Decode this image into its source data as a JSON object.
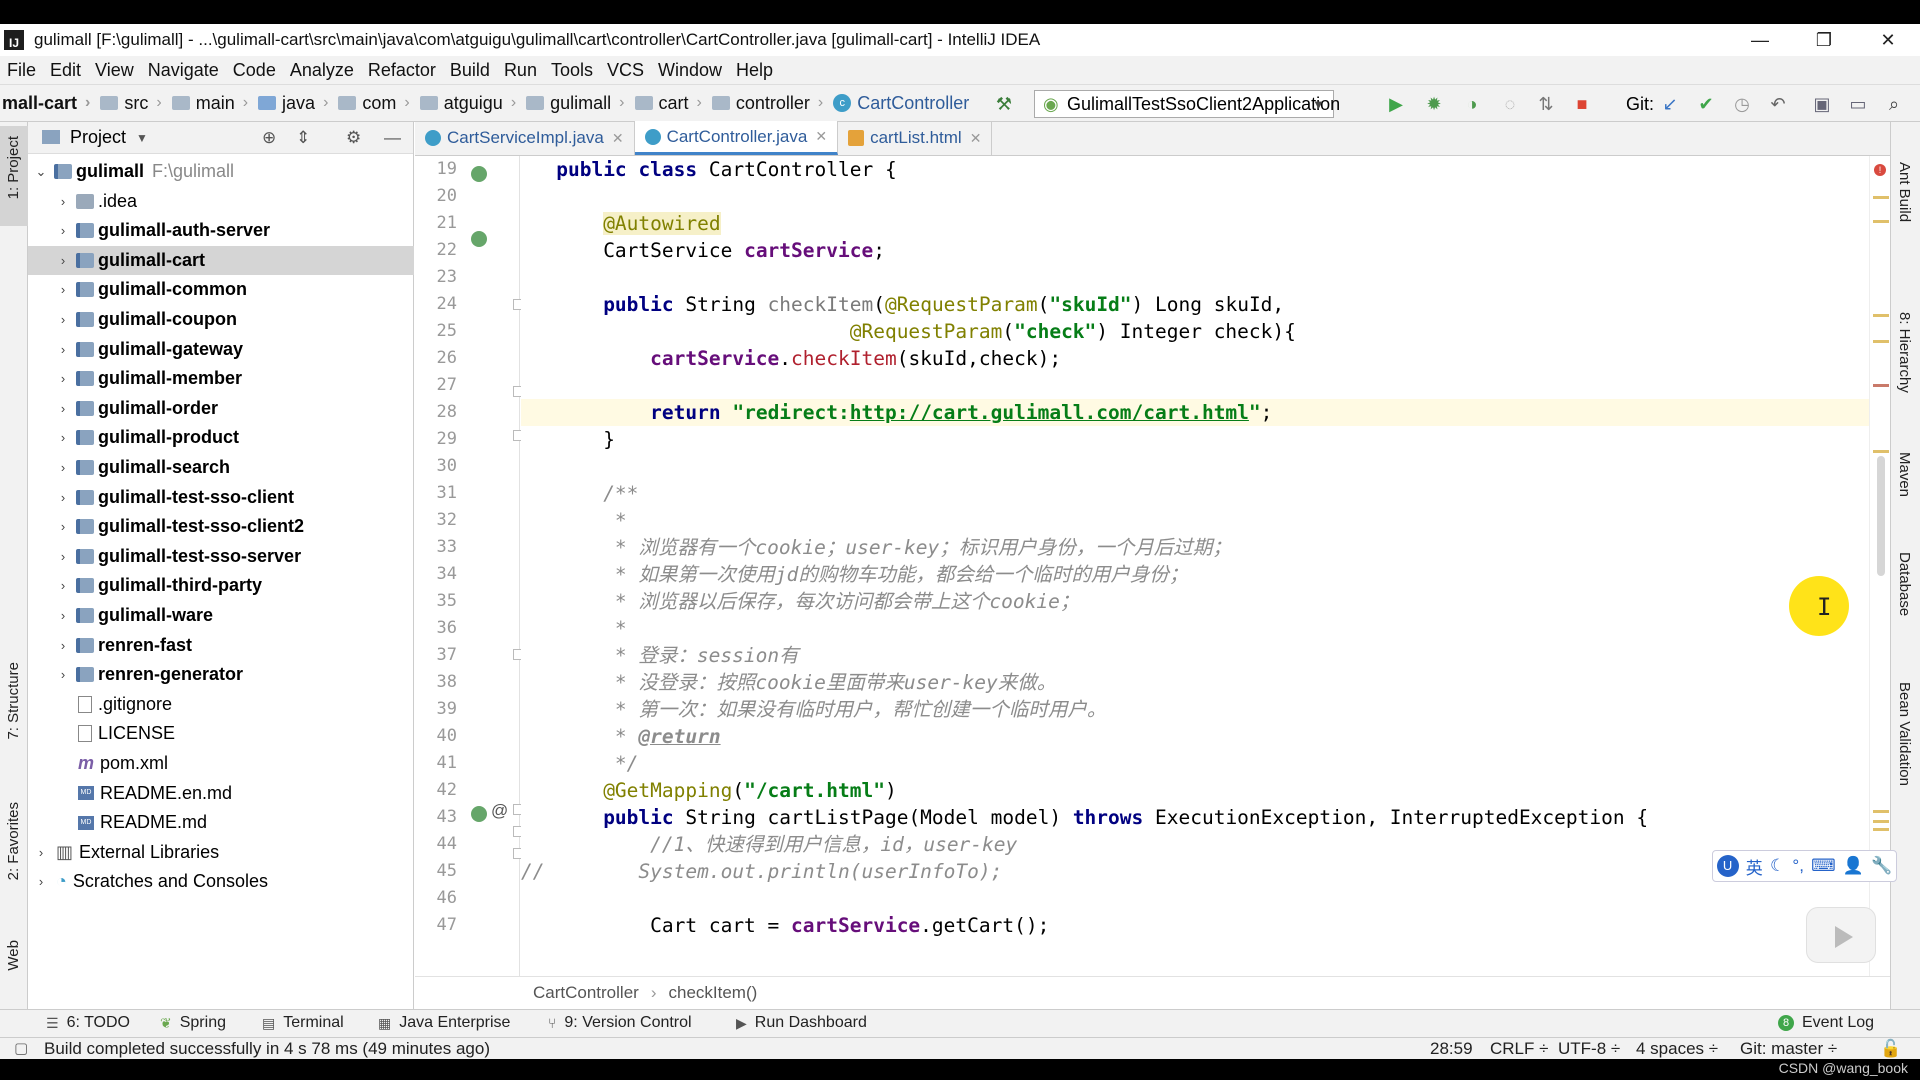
{
  "window": {
    "title": "gulimall [F:\\gulimall] - ...\\gulimall-cart\\src\\main\\java\\com\\atguigu\\gulimall\\cart\\controller\\CartController.java [gulimall-cart] - IntelliJ IDEA",
    "minimize": "—",
    "restore": "❐",
    "close": "✕"
  },
  "menu": [
    "File",
    "Edit",
    "View",
    "Navigate",
    "Code",
    "Analyze",
    "Refactor",
    "Build",
    "Run",
    "Tools",
    "VCS",
    "Window",
    "Help"
  ],
  "nav": {
    "crumbs": [
      "mall-cart",
      "src",
      "main",
      "java",
      "com",
      "atguigu",
      "gulimall",
      "cart",
      "controller",
      "CartController"
    ],
    "run_config": "GulimallTestSsoClient2Application",
    "git_label": "Git:"
  },
  "left_strip": {
    "project": "1: Project",
    "structure": "7: Structure",
    "favorites": "2: Favorites",
    "web": "Web"
  },
  "right_strip": {
    "ant": "Ant Build",
    "hierarchy": "8: Hierarchy",
    "maven": "Maven",
    "database": "Database",
    "bean": "Bean Validation"
  },
  "project": {
    "header": "Project",
    "root_name": "gulimall",
    "root_path": "F:\\gulimall",
    "modules": [
      "gulimall-auth-server",
      "gulimall-cart",
      "gulimall-common",
      "gulimall-coupon",
      "gulimall-gateway",
      "gulimall-member",
      "gulimall-order",
      "gulimall-product",
      "gulimall-search",
      "gulimall-test-sso-client",
      "gulimall-test-sso-client2",
      "gulimall-test-sso-server",
      "gulimall-third-party",
      "gulimall-ware",
      "renren-fast",
      "renren-generator"
    ],
    "idea": ".idea",
    "files": [
      ".gitignore",
      "LICENSE",
      "pom.xml",
      "README.en.md",
      "README.md"
    ],
    "external": "External Libraries",
    "scratches": "Scratches and Consoles"
  },
  "tabs": [
    "CartServiceImpl.java",
    "CartController.java",
    "cartList.html"
  ],
  "line_numbers": [
    "19",
    "20",
    "21",
    "22",
    "23",
    "24",
    "25",
    "26",
    "27",
    "28",
    "29",
    "30",
    "31",
    "32",
    "33",
    "34",
    "35",
    "36",
    "37",
    "38",
    "39",
    "40",
    "41",
    "42",
    "43",
    "44",
    "45",
    "46",
    "47"
  ],
  "code": {
    "l19_pub": "public",
    "l19_cls": "class",
    "l19_name": " CartController {",
    "l21_ann": "@Autowired",
    "l22_type": "CartService ",
    "l22_fld": "cartService",
    "l22_end": ";",
    "l24_pub": "public",
    "l24_type": " String ",
    "l24_m": "checkItem",
    "l24_open": "(",
    "l24_ann": "@RequestParam",
    "l24_p1": "(",
    "l24_s": "\"skuId\"",
    "l24_rest": ") Long skuId,",
    "l25_ann": "@RequestParam",
    "l25_p1": "(",
    "l25_s": "\"check\"",
    "l25_rest": ") Integer check){",
    "l26_fld": "cartService",
    "l26_dot": ".",
    "l26_m": "checkItem",
    "l26_rest": "(skuId,check);",
    "l28_ret": "return",
    "l28_s1": "\"redirect:",
    "l28_url": "http://cart.gulimall.com/cart.html",
    "l28_s2": "\"",
    "l28_end": ";",
    "l29": "}",
    "l31": "/**",
    "l32": " *",
    "l33": " * 浏览器有一个cookie；user-key；标识用户身份，一个月后过期；",
    "l34": " * 如果第一次使用jd的购物车功能，都会给一个临时的用户身份；",
    "l35": " * 浏览器以后保存，每次访问都会带上这个cookie；",
    "l36": " *",
    "l37": " * 登录：session有",
    "l38": " * 没登录：按照cookie里面带来user-key来做。",
    "l39": " * 第一次：如果没有临时用户，帮忙创建一个临时用户。",
    "l40_star": " * ",
    "l40_tag": "@return",
    "l41": " */",
    "l42_ann": "@GetMapping",
    "l42_p": "(",
    "l42_s": "\"/cart.html\"",
    "l42_e": ")",
    "l43_pub": "public",
    "l43_rest": " String cartListPage(Model model) ",
    "l43_thr": "throws",
    "l43_exc": " ExecutionException, InterruptedException {",
    "l44": "//1、快速得到用户信息，id，user-key",
    "l45": "//        System.out.println(userInfoTo);",
    "l47_a": "Cart cart = ",
    "l47_fld": "cartService",
    "l47_b": ".getCart();"
  },
  "editor_breadcrumb": [
    "CartController",
    "checkItem()"
  ],
  "ime": {
    "u": "U",
    "lang": "英",
    "moon": "☾",
    "punct": "°,",
    "kbd": "⌨",
    "user": "👤",
    "wrench": "🔧"
  },
  "bottom_tools": {
    "todo": "6: TODO",
    "spring": "Spring",
    "terminal": "Terminal",
    "java_ent": "Java Enterprise",
    "vcs": "9: Version Control",
    "run_dash": "Run Dashboard",
    "event_log": "Event Log",
    "event_count": "8"
  },
  "status": {
    "message": "Build completed successfully in 4 s 78 ms (49 minutes ago)",
    "position": "28:59",
    "line_sep": "CRLF ÷",
    "encoding": "UTF-8 ÷",
    "indent": "4 spaces ÷",
    "git": "Git: master ÷"
  },
  "watermark": "CSDN @wang_book",
  "colors": {
    "keyword": "#000080",
    "annotation": "#808000",
    "string": "#067d17",
    "field": "#660e7a",
    "method": "#b0202e",
    "comment": "#8c8c8c",
    "highlight": "#ffe000"
  }
}
